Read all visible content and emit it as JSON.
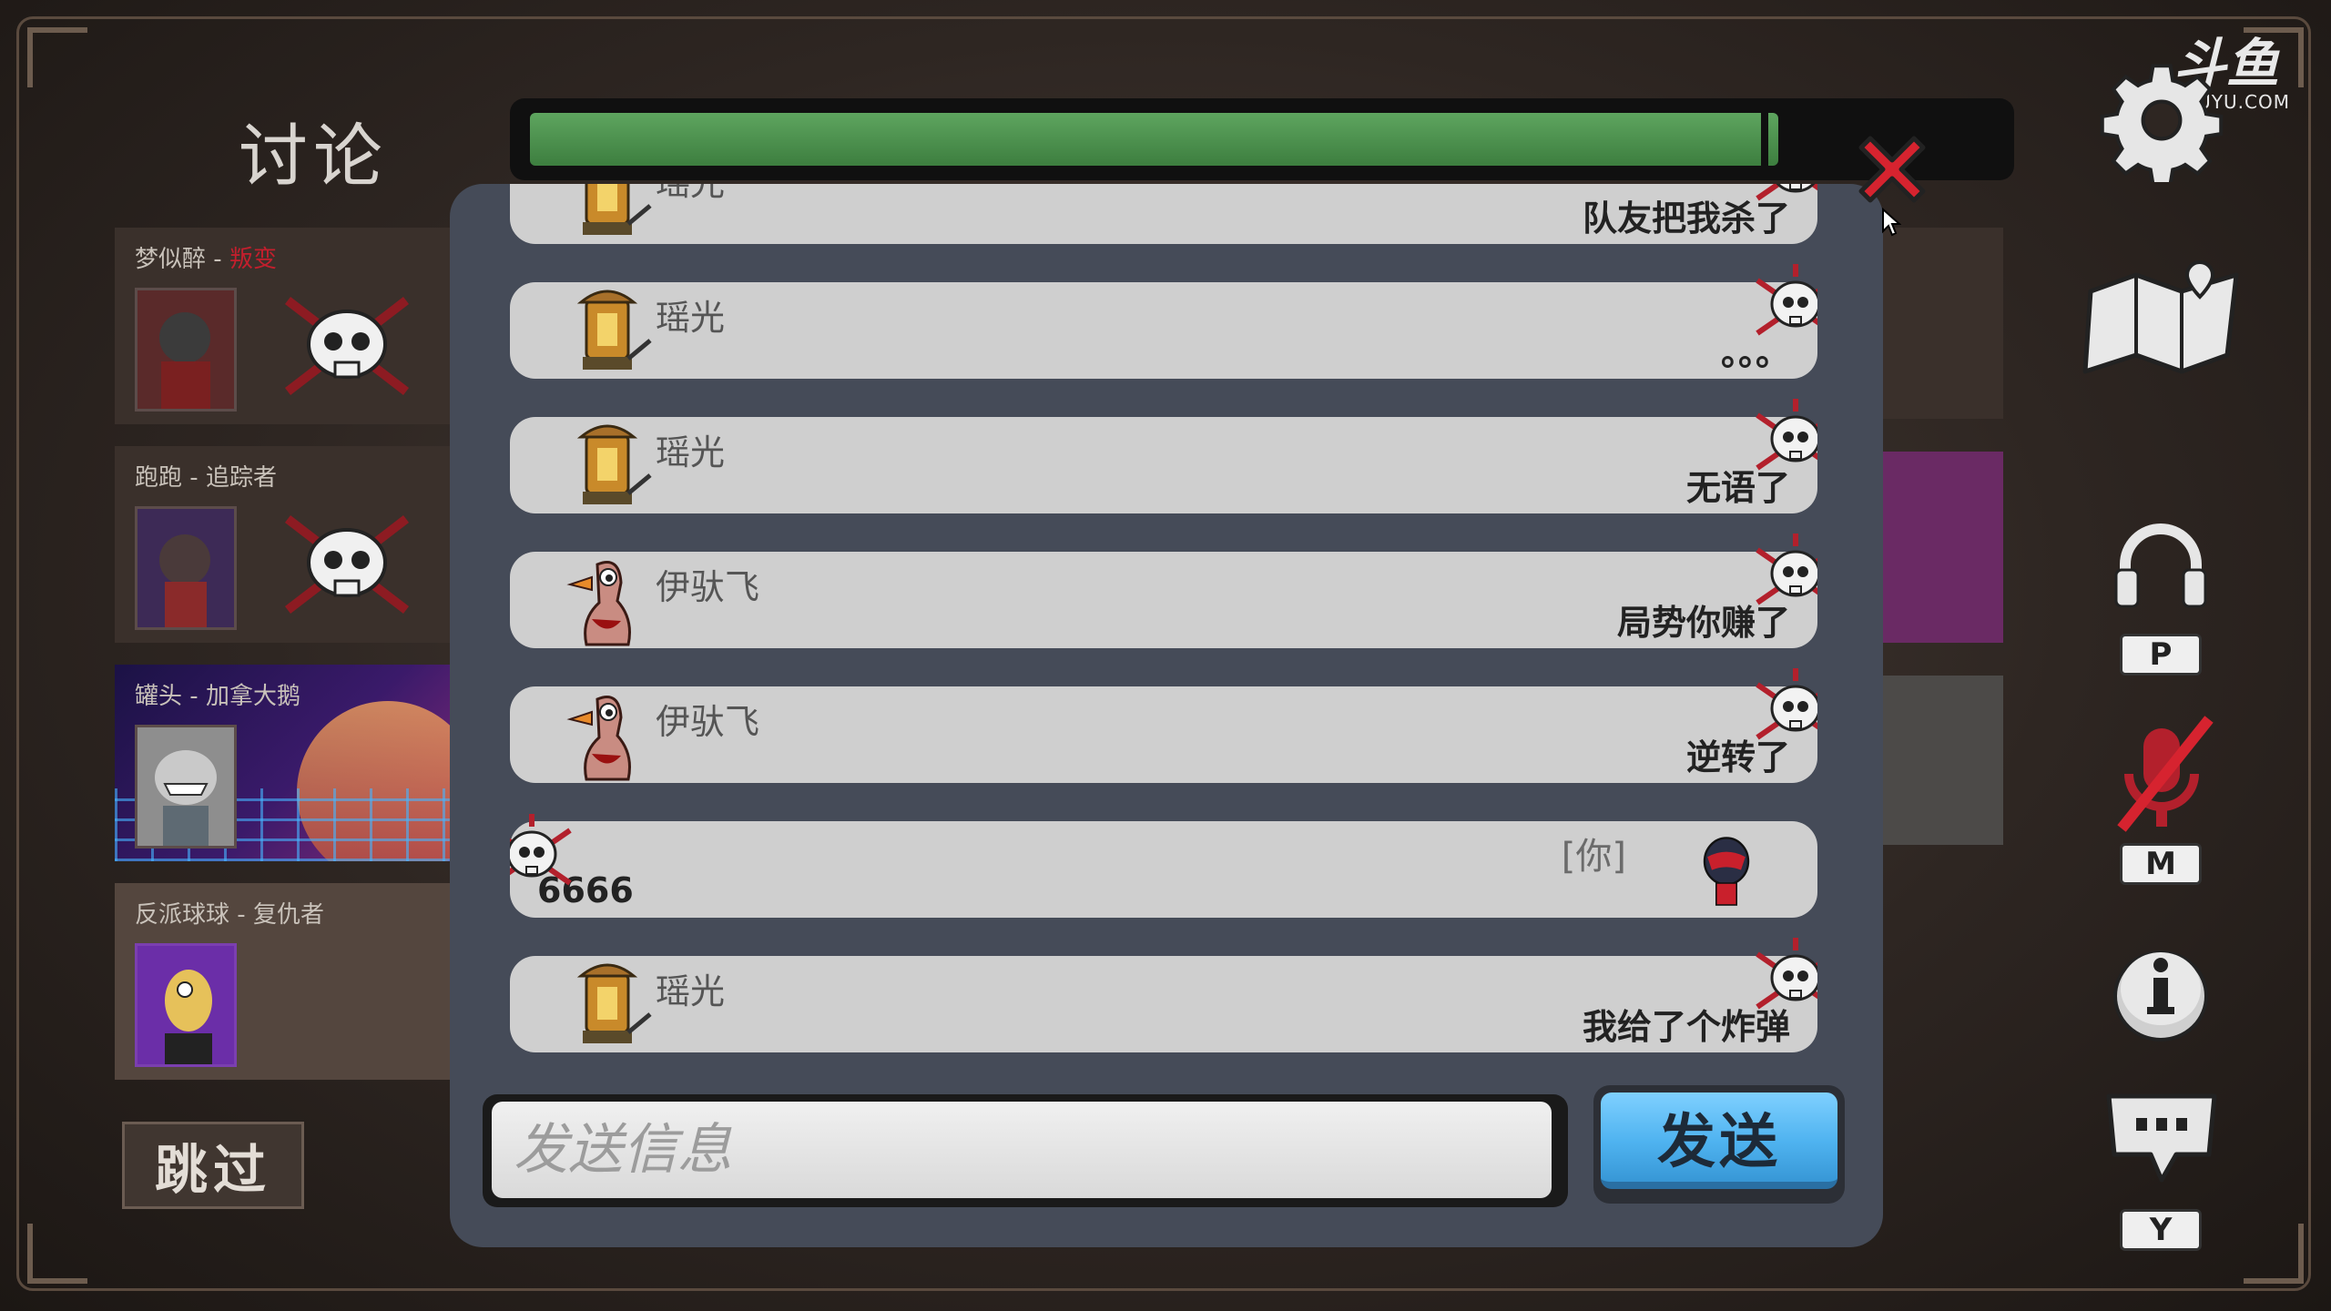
{
  "screen": {
    "title": "讨论",
    "timer_progress_percent": 89,
    "watermark": {
      "logo_text": "斗鱼",
      "site": "DOUYU.COM"
    }
  },
  "players": [
    {
      "name": "梦似醉",
      "role": "叛变",
      "role_color": "#c21f2d",
      "dead": true
    },
    {
      "name": "跑跑",
      "role": "追踪者",
      "dead": true
    },
    {
      "name": "罐头",
      "role": "加拿大鹅",
      "dead": false
    },
    {
      "name": "反派球球",
      "role": "复仇者",
      "dead": false
    }
  ],
  "separator": " - ",
  "skip_label": "跳过",
  "chat": {
    "messages": [
      {
        "sender": "瑶光",
        "text": "队友把我杀了",
        "avatar": "lantern-goose"
      },
      {
        "sender": "瑶光",
        "text": "。。。",
        "avatar": "lantern-goose"
      },
      {
        "sender": "瑶光",
        "text": "无语了",
        "avatar": "lantern-goose"
      },
      {
        "sender": "伊驮飞",
        "text": "局势你赚了",
        "avatar": "pink-goose"
      },
      {
        "sender": "伊驮飞",
        "text": "逆转了",
        "avatar": "pink-goose"
      },
      {
        "sender": "",
        "text": "6666",
        "you_tag": "[你]",
        "avatar": "helmet-goose",
        "is_me": true
      },
      {
        "sender": "瑶光",
        "text": "我给了个炸弹",
        "avatar": "lantern-goose"
      }
    ],
    "input_placeholder": "发送信息",
    "send_label": "发送"
  },
  "sidebar": {
    "push_to_talk_key": "P",
    "mute_key": "M",
    "chat_key": "Y"
  },
  "colors": {
    "accent_blue": "#4fb3f0",
    "timer_green": "#4f9a51",
    "close_red": "#d6232f"
  }
}
